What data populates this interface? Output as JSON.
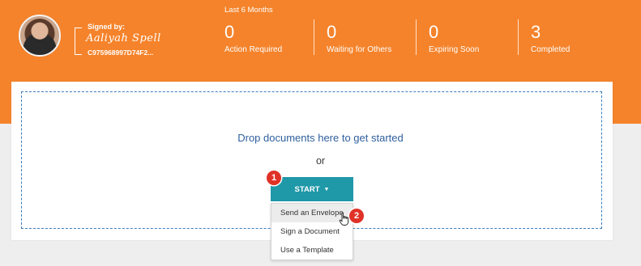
{
  "signer": {
    "signed_by_label": "Signed by:",
    "signature_text": "Aaliyah Spell",
    "signer_id": "C975968997D74F2..."
  },
  "summary": {
    "period": "Last 6 Months",
    "stats": [
      {
        "value": "0",
        "label": "Action Required"
      },
      {
        "value": "0",
        "label": "Waiting for Others"
      },
      {
        "value": "0",
        "label": "Expiring Soon"
      },
      {
        "value": "3",
        "label": "Completed"
      }
    ]
  },
  "dropzone": {
    "prompt": "Drop documents here to get started",
    "or": "or"
  },
  "start": {
    "label": "START",
    "menu": [
      "Send an Envelope",
      "Sign a Document",
      "Use a Template"
    ]
  },
  "callouts": [
    "1",
    "2"
  ],
  "colors": {
    "header": "#f5832b",
    "button": "#1f98a8",
    "link": "#2f5f9e",
    "callout": "#e03127"
  }
}
